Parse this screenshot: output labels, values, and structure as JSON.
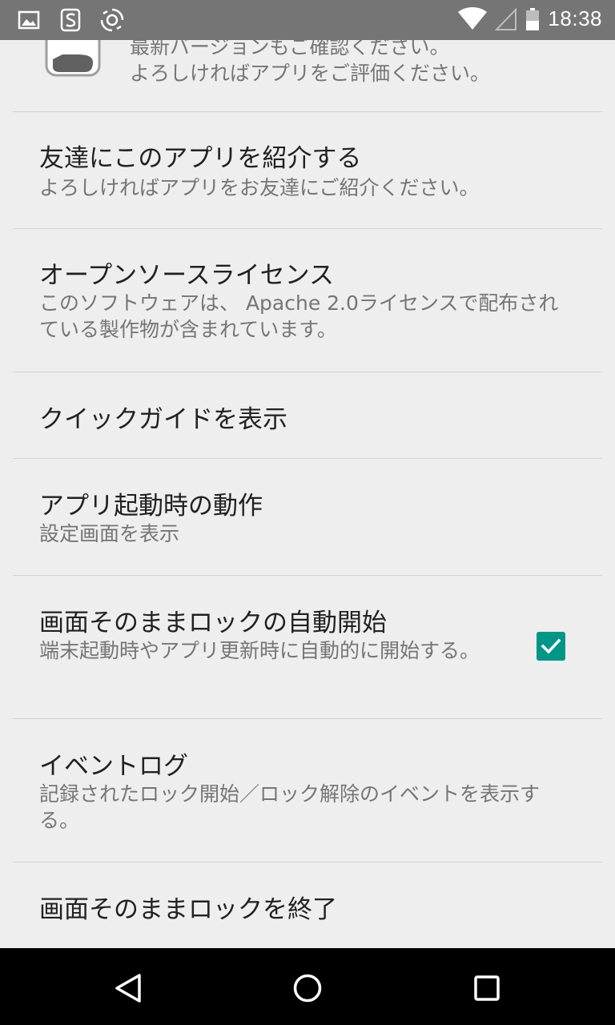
{
  "status_bar": {
    "time": "18:38",
    "left_icons": [
      "gallery-icon",
      "app-s-icon",
      "sync-swirl-icon"
    ],
    "right_icons": [
      "wifi-icon",
      "cell-signal-icon",
      "battery-icon"
    ]
  },
  "settings": {
    "top_item": {
      "summary_line1": "最新バージョンもご確認ください。",
      "summary_line2": "よろしければアプリをご評価ください。"
    },
    "items": [
      {
        "title": "友達にこのアプリを紹介する",
        "summary": "よろしければアプリをお友達にご紹介ください。"
      },
      {
        "title": "オープンソースライセンス",
        "summary": "このソフトウェアは、 Apache 2.0ライセンスで配布されている製作物が含まれています。"
      },
      {
        "title": "クイックガイドを表示",
        "summary": ""
      },
      {
        "title": "アプリ起動時の動作",
        "summary": "設定画面を表示"
      },
      {
        "title": "画面そのままロックの自動開始",
        "summary": "端末起動時やアプリ更新時に自動的に開始する。",
        "checked": true
      },
      {
        "title": "イベントログ",
        "summary": "記録されたロック開始／ロック解除のイベントを表示する。"
      },
      {
        "title": "画面そのままロックを終了",
        "summary": ""
      }
    ]
  },
  "colors": {
    "accent": "#009688",
    "status_bar": "#757575",
    "background": "#eeeeee"
  },
  "nav_bar": {
    "buttons": [
      "back-icon",
      "home-icon",
      "recents-icon"
    ]
  }
}
